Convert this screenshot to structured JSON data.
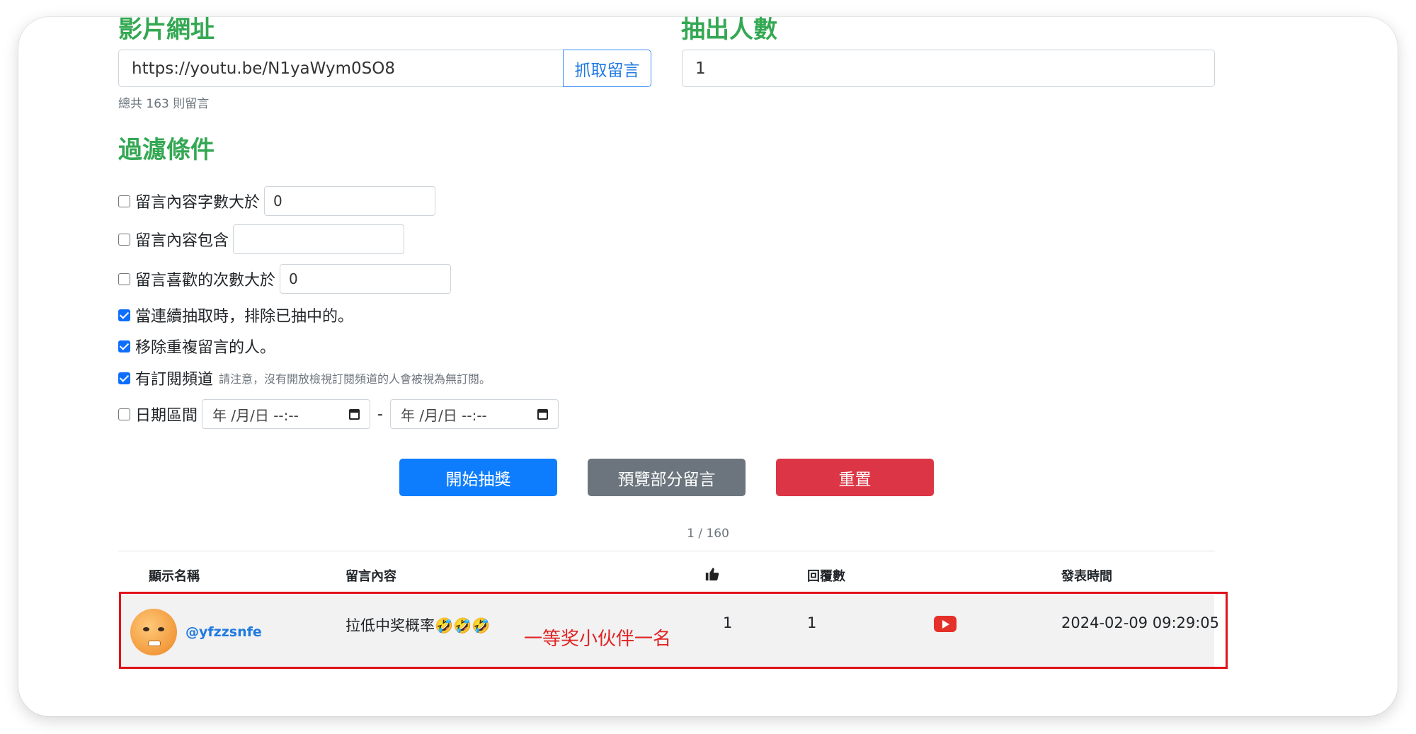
{
  "video_url": {
    "heading": "影片網址",
    "value": "https://youtu.be/N1yaWym0SO8",
    "fetch_button": "抓取留言",
    "total_text": "總共 163 則留言"
  },
  "draw_count": {
    "heading": "抽出人數",
    "value": "1"
  },
  "filters": {
    "heading": "過濾條件",
    "min_length": {
      "label": "留言內容字數大於",
      "checked": false,
      "value": "0"
    },
    "contains": {
      "label": "留言內容包含",
      "checked": false,
      "value": ""
    },
    "min_likes": {
      "label": "留言喜歡的次數大於",
      "checked": false,
      "value": "0"
    },
    "exclude_drawn": {
      "label": "當連續抽取時，排除已抽中的。",
      "checked": true
    },
    "remove_duplicates": {
      "label": "移除重複留言的人。",
      "checked": true
    },
    "subscribed": {
      "label": "有訂閱頻道",
      "checked": true,
      "note": "請注意，沒有開放檢視訂閱頻道的人會被視為無訂閱。"
    },
    "date_range": {
      "label": "日期區間",
      "checked": false,
      "start_placeholder": "年 /月/日 --:--",
      "end_placeholder": "年 /月/日 --:--",
      "separator": "-"
    }
  },
  "actions": {
    "start": "開始抽獎",
    "preview": "預覽部分留言",
    "reset": "重置"
  },
  "pager": "1 / 160",
  "table": {
    "headers": {
      "name": "顯示名稱",
      "content": "留言內容",
      "likes_icon": "thumbs-up-icon",
      "replies": "回覆數",
      "time": "發表時間"
    },
    "rows": [
      {
        "handle": "@yfzzsnfe",
        "content": "拉低中奖概率🤣🤣🤣",
        "likes": "1",
        "replies": "1",
        "link_icon": "youtube-icon",
        "time": "2024-02-09 09:29:05"
      }
    ]
  },
  "annotation": "一等奖小伙伴一名",
  "colors": {
    "heading": "#34a853",
    "primary": "#0d7dfd",
    "secondary": "#6c757d",
    "danger": "#dc3545",
    "highlight": "#e0131a"
  }
}
